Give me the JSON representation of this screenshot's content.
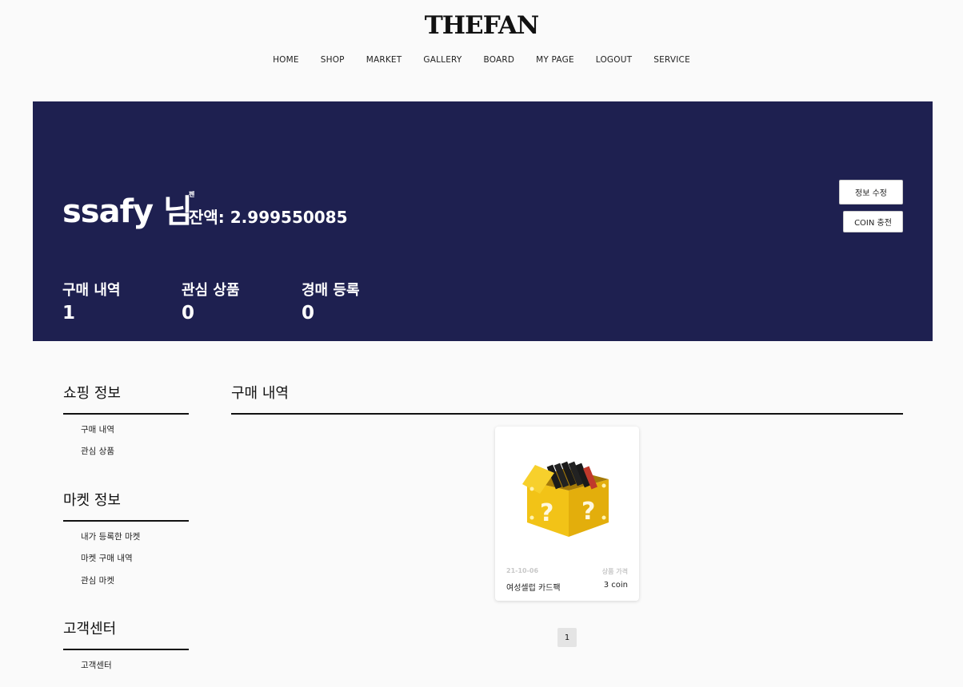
{
  "brand": "THEFAN",
  "nav": [
    "HOME",
    "SHOP",
    "MARKET",
    "GALLERY",
    "BOARD",
    "MY PAGE",
    "LOGOUT",
    "SERVICE"
  ],
  "profile": {
    "name": "ssafy 님",
    "unit": "펜",
    "balance": "잔액: 2.999550085",
    "edit_button": "정보 수정",
    "charge_button": "COIN 충전"
  },
  "stats": [
    {
      "label": "구매 내역",
      "value": "1"
    },
    {
      "label": "관심 상품",
      "value": "0"
    },
    {
      "label": "경매 등록",
      "value": "0"
    }
  ],
  "sidebar": {
    "shopping": {
      "title": "쇼핑 정보",
      "items": [
        "구매 내역",
        "관심 상품"
      ]
    },
    "market": {
      "title": "마켓 정보",
      "items": [
        "내가 등록한 마켓",
        "마켓 구매 내역",
        "관심 마켓"
      ]
    },
    "support": {
      "title": "고객센터",
      "items": [
        "고객센터"
      ]
    }
  },
  "main": {
    "title": "구매 내역",
    "products": [
      {
        "date": "21-10-06",
        "price_label": "상품 가격",
        "name": "여성셀럽 카드팩",
        "price": "3 coin",
        "image_icon": "question-block-icon"
      }
    ],
    "pagination": [
      "1"
    ]
  }
}
